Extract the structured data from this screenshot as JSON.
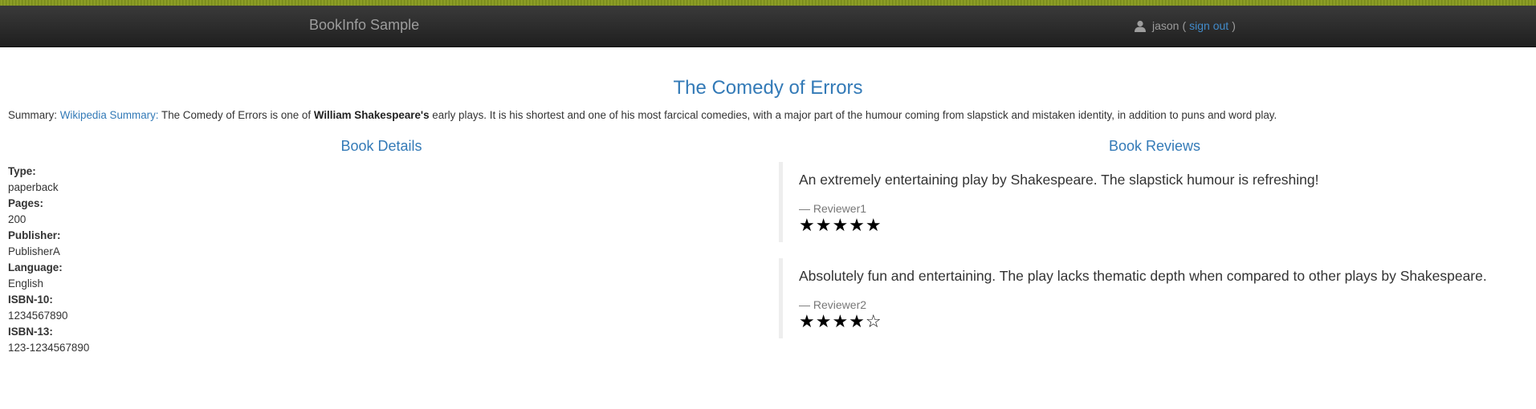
{
  "navbar": {
    "brand": "BookInfo Sample",
    "user": {
      "name": "jason",
      "open_paren": "(",
      "signout_label": "sign out",
      "close_paren": ")"
    }
  },
  "book": {
    "title": "The Comedy of Errors",
    "summary": {
      "prefix": "Summary:",
      "link_label": "Wikipedia Summary:",
      "text_before": "The Comedy of Errors is one of",
      "bold_text": "William Shakespeare's",
      "text_after": "early plays. It is his shortest and one of his most farcical comedies, with a major part of the humour coming from slapstick and mistaken identity, in addition to puns and word play."
    }
  },
  "details": {
    "heading": "Book Details",
    "fields": [
      {
        "label": "Type:",
        "value": "paperback"
      },
      {
        "label": "Pages:",
        "value": "200"
      },
      {
        "label": "Publisher:",
        "value": "PublisherA"
      },
      {
        "label": "Language:",
        "value": "English"
      },
      {
        "label": "ISBN-10:",
        "value": "1234567890"
      },
      {
        "label": "ISBN-13:",
        "value": "123-1234567890"
      }
    ]
  },
  "reviews": {
    "heading": "Book Reviews",
    "items": [
      {
        "text": "An extremely entertaining play by Shakespeare. The slapstick humour is refreshing!",
        "author": "— Reviewer1",
        "rating": 5,
        "rating_max": 5,
        "stars": "★★★★★"
      },
      {
        "text": "Absolutely fun and entertaining. The play lacks thematic depth when compared to other plays by Shakespeare.",
        "author": "— Reviewer2",
        "rating": 4,
        "rating_max": 5,
        "stars": "★★★★☆"
      }
    ]
  },
  "colors": {
    "link": "#337ab7",
    "navbar_bg": "#222222",
    "navbar_text": "#9d9d9d"
  }
}
